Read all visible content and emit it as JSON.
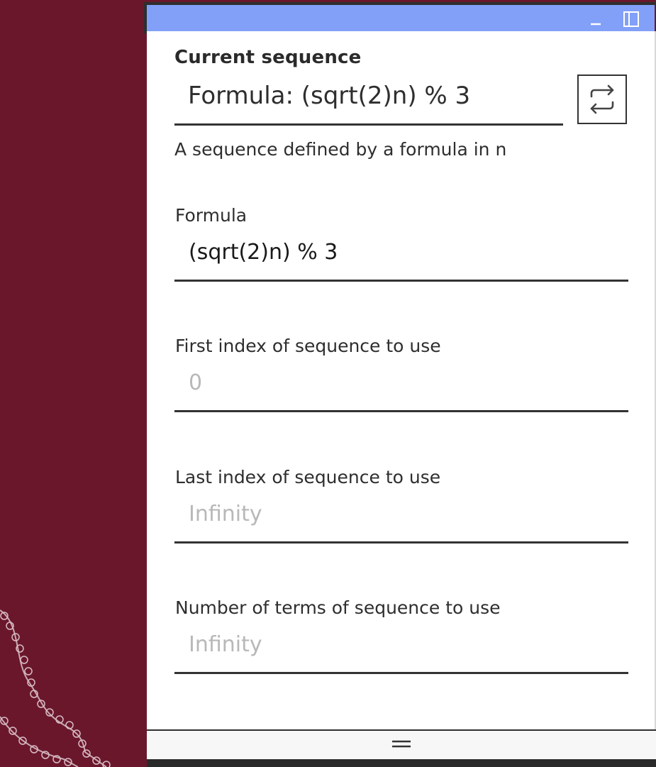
{
  "colors": {
    "background": "#6a172c",
    "titlebar": "#82a0f8",
    "panel": "#ffffff",
    "placeholder": "#b8b8b8"
  },
  "titlebar": {
    "minimize_icon": "minimize-icon",
    "maximize_icon": "panel-layout-icon"
  },
  "current_sequence": {
    "heading": "Current sequence",
    "value": "Formula: (sqrt(2)n) % 3",
    "swap_icon": "swap-arrows-icon",
    "description": "A sequence defined by a formula in n"
  },
  "fields": {
    "formula": {
      "label": "Formula",
      "value": "(sqrt(2)n) % 3"
    },
    "first_index": {
      "label": "First index of sequence to use",
      "placeholder": "0"
    },
    "last_index": {
      "label": "Last index of sequence to use",
      "placeholder": "Infinity"
    },
    "num_terms": {
      "label": "Number of terms of sequence to use",
      "placeholder": "Infinity"
    }
  },
  "resize_handle_icon": "drag-handle-icon"
}
